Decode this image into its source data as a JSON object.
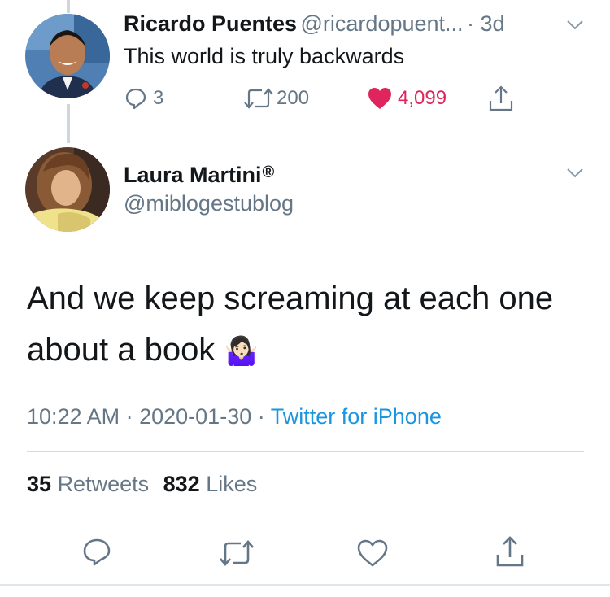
{
  "parent_tweet": {
    "name": "Ricardo Puentes",
    "handle": "@ricardopuent...",
    "time": "· 3d",
    "text": "This world is truly backwards",
    "replies": "3",
    "retweets": "200",
    "likes": "4,099",
    "liked_color": "#e0245e"
  },
  "tweet": {
    "name": "Laura Martini",
    "verified_mark": "®",
    "handle": "@miblogestublog",
    "text_line1": "And we keep screaming at each one",
    "text_line2": "about a book",
    "emoji": "🤷🏻‍♀️",
    "time": "10:22 AM",
    "date": "2020-01-30",
    "sep": "·",
    "source": "Twitter for iPhone",
    "retweet_count": "35",
    "retweet_label": "Retweets",
    "like_count": "832",
    "like_label": "Likes"
  },
  "colors": {
    "link": "#1b95e0",
    "grey": "#657786",
    "like": "#e0245e"
  }
}
